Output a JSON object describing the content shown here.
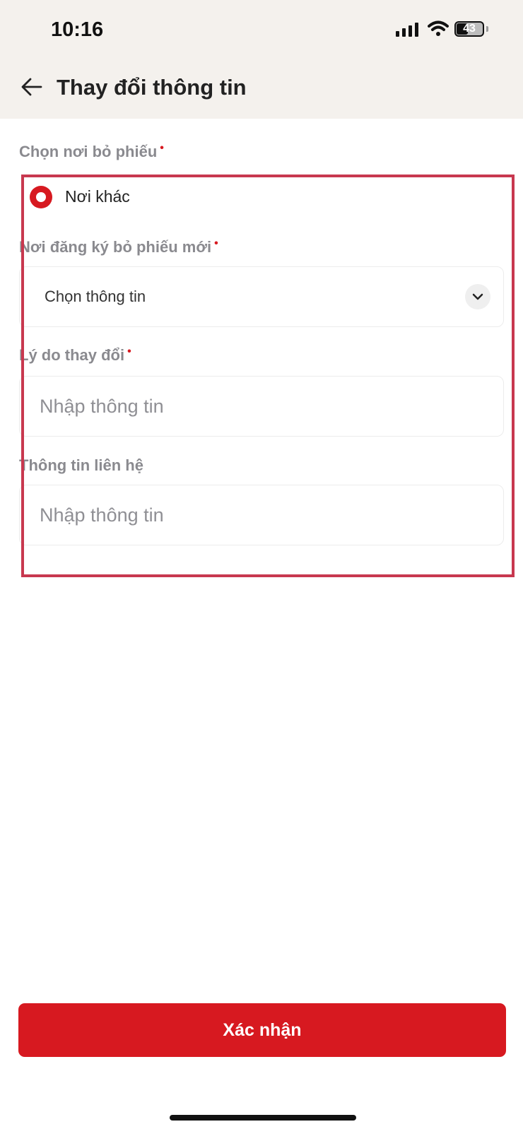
{
  "status_bar": {
    "time": "10:16",
    "battery_level": "43"
  },
  "header": {
    "title": "Thay đổi thông tin"
  },
  "form": {
    "polling_place": {
      "label": "Chọn nơi bỏ phiếu",
      "required_mark": "•",
      "selected_option": "Nơi khác"
    },
    "new_registration_place": {
      "label": "Nơi đăng ký bỏ phiếu mới",
      "required_mark": "•",
      "value": "Chọn thông tin"
    },
    "change_reason": {
      "label": "Lý do thay đổi",
      "required_mark": "•",
      "placeholder": "Nhập thông tin"
    },
    "contact_info": {
      "label": "Thông tin liên hệ",
      "placeholder": "Nhập thông tin"
    }
  },
  "footer": {
    "confirm_label": "Xác nhận"
  },
  "colors": {
    "accent": "#d71920",
    "highlight": "#c8384f",
    "header_bg": "#f4f1ed",
    "label": "#8a8a8f"
  }
}
